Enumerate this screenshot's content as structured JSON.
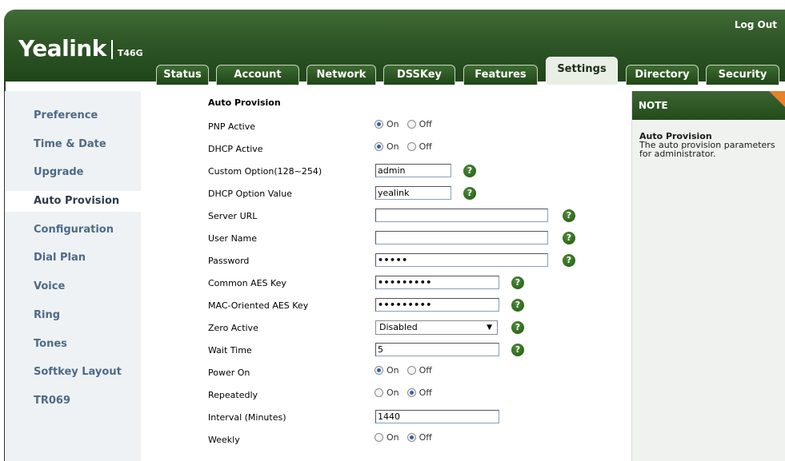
{
  "header": {
    "brand": "Yealink",
    "model": "T46G",
    "logout_label": "Log Out"
  },
  "tabs": [
    {
      "label": "Status",
      "active": false
    },
    {
      "label": "Account",
      "active": false
    },
    {
      "label": "Network",
      "active": false
    },
    {
      "label": "DSSKey",
      "active": false
    },
    {
      "label": "Features",
      "active": false
    },
    {
      "label": "Settings",
      "active": true
    },
    {
      "label": "Directory",
      "active": false
    },
    {
      "label": "Security",
      "active": false
    }
  ],
  "sidebar": {
    "items": [
      {
        "label": "Preference"
      },
      {
        "label": "Time & Date"
      },
      {
        "label": "Upgrade"
      },
      {
        "label": "Auto Provision",
        "active": true
      },
      {
        "label": "Configuration"
      },
      {
        "label": "Dial Plan"
      },
      {
        "label": "Voice"
      },
      {
        "label": "Ring"
      },
      {
        "label": "Tones"
      },
      {
        "label": "Softkey Layout"
      },
      {
        "label": "TR069"
      }
    ]
  },
  "form": {
    "section_title": "Auto Provision",
    "on_label": "On",
    "off_label": "Off",
    "pnp_active": {
      "label": "PNP Active",
      "value": "On"
    },
    "dhcp_active": {
      "label": "DHCP Active",
      "value": "On"
    },
    "custom_option": {
      "label": "Custom Option(128~254)",
      "value": "admin"
    },
    "dhcp_option_value": {
      "label": "DHCP Option Value",
      "value": "yealink"
    },
    "server_url": {
      "label": "Server URL",
      "value": ""
    },
    "user_name": {
      "label": "User Name",
      "value": ""
    },
    "password": {
      "label": "Password",
      "value": "•••••"
    },
    "common_aes_key": {
      "label": "Common AES Key",
      "value": "•••••••••"
    },
    "mac_aes_key": {
      "label": "MAC-Oriented AES Key",
      "value": "•••••••••"
    },
    "zero_active": {
      "label": "Zero Active",
      "value": "Disabled"
    },
    "wait_time": {
      "label": "Wait Time",
      "value": "5"
    },
    "power_on": {
      "label": "Power On",
      "value": "On"
    },
    "repeatedly": {
      "label": "Repeatedly",
      "value": "Off"
    },
    "interval": {
      "label": "Interval (Minutes)",
      "value": "1440"
    },
    "weekly": {
      "label": "Weekly",
      "value": "Off"
    }
  },
  "note": {
    "heading": "NOTE",
    "title": "Auto Provision",
    "text": "The auto provision parameters for administrator."
  },
  "colors": {
    "header_green": "#2e5626",
    "sidebar_text": "#4e6a87",
    "note_corner": "#e8812a",
    "help_icon": "#2f6e1f"
  }
}
